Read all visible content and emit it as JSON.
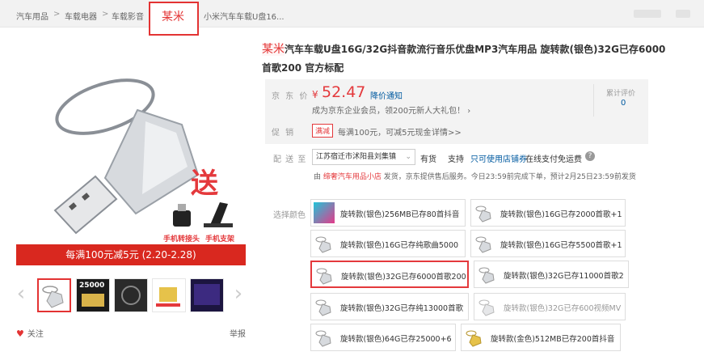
{
  "breadcrumb": {
    "items": [
      "汽车用品",
      "车载电器",
      "车载影音"
    ],
    "separator": ">",
    "brand": "某米",
    "product_short": "小米汽车车载U盘16..."
  },
  "product": {
    "title_brand": "某米",
    "title_rest": "汽车车载U盘16G/32G抖音款流行音乐优盘MP3汽车用品 旋转款(银色)32G已存6000首歌200 官方标配"
  },
  "main_image": {
    "send_text": "送",
    "accessory_1": "手机转接头",
    "accessory_2": "手机支架",
    "promo_banner": "每满100元减5元 (2.20-2.28)"
  },
  "gallery": {
    "prev_arrow": "‹",
    "next_arrow": "›",
    "thumb_2_label": "25000"
  },
  "actions": {
    "follow_icon": "heart-icon",
    "follow_label": "关注",
    "report_label": "举报"
  },
  "price": {
    "label": "京 东 价",
    "currency": "¥",
    "value": "52.47",
    "notice": "降价通知",
    "member_text": "成为京东企业会员，领200元新人大礼包！",
    "member_chevron": "›",
    "review_label": "累计评价",
    "review_count": "0"
  },
  "promotion": {
    "label": "促  销",
    "tag": "满减",
    "text": "每满100元，可减5元现金",
    "detail": "详情>>"
  },
  "shipping": {
    "label": "配 送 至",
    "address": "江苏宿迁市沭阳县刘集镇",
    "stock": "有货",
    "support_label": "支持",
    "store_pickup": "只可使用店铺券",
    "online_pay": "在线支付免运费",
    "help_icon": "question-icon"
  },
  "seller": {
    "prefix": "由",
    "store": "缔奢汽车用品小店",
    "text": "发货，京东提供售后服务。今日23:59前完成下单，预计2月25日23:59前发货"
  },
  "options": {
    "label": "选择颜色",
    "items": [
      {
        "text": "旋转款(银色)256MB已存80首抖音"
      },
      {
        "text": "旋转款(银色)16G已存2000首歌+1"
      },
      {
        "text": "旋转款(银色)16G已存纯歌曲5000"
      },
      {
        "text": "旋转款(银色)16G已存5500首歌+1"
      },
      {
        "text": "旋转款(银色)32G已存6000首歌200"
      },
      {
        "text": "旋转款(银色)32G已存11000首歌2"
      },
      {
        "text": "旋转款(银色)32G已存纯13000首歌"
      },
      {
        "text": "旋转款(银色)32G已存600视频MV"
      },
      {
        "text": "旋转款(银色)64G已存25000+6"
      },
      {
        "text": "旋转款(金色)512MB已存200首抖音"
      }
    ]
  },
  "colors": {
    "accent": "#e4393c",
    "link": "#005aa0",
    "banner": "#d9281f"
  }
}
